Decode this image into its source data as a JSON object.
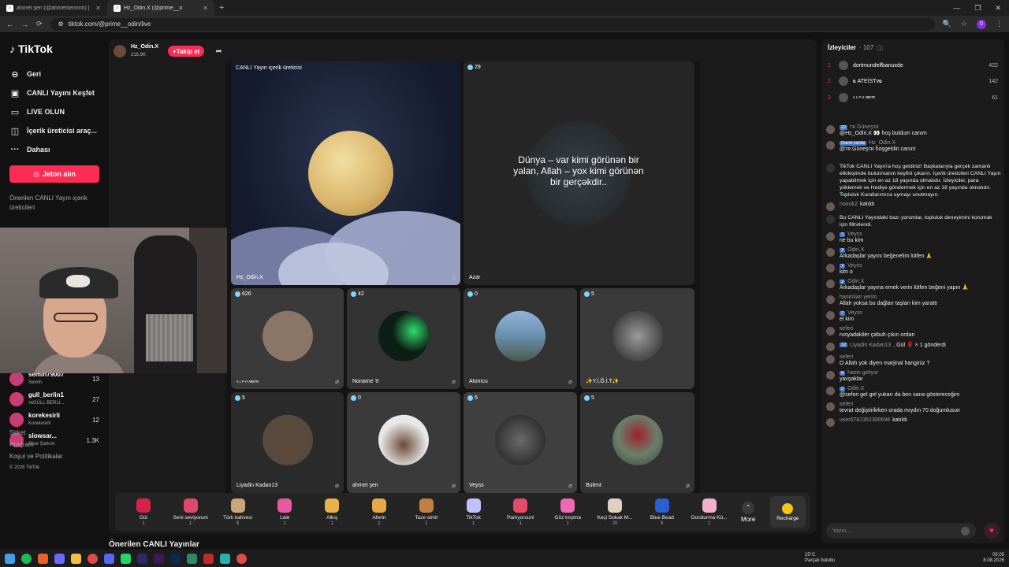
{
  "browser": {
    "tabs": [
      {
        "label": "ahmet şen (@ahmetsennnn) |",
        "active": false
      },
      {
        "label": "Hz_Odin.X (@prime__o",
        "active": true
      }
    ],
    "url": "tiktok.com/@prime__odin/live",
    "profile_initial": "0"
  },
  "sidebar": {
    "logo": "TikTok",
    "nav": [
      {
        "icon": "arrow-left-icon",
        "label": "Geri"
      },
      {
        "icon": "live-tv-icon",
        "label": "CANLI Yayını Keşfet"
      },
      {
        "icon": "camera-icon",
        "label": "LIVE OLUN"
      },
      {
        "icon": "creator-tools-icon",
        "label": "İçerik üreticisi araç..."
      },
      {
        "icon": "more-icon",
        "label": "Dahası"
      }
    ],
    "jeton_button": "Jeton alın",
    "suggested_heading": "Önerilen CANLI Yayın içerik üreticileri",
    "accounts": [
      {
        "name": "semih79007",
        "sub": "Semih",
        "count": "13"
      },
      {
        "name": "gull_berlin1",
        "sub": "ᴛʀGÜLL BERLİ...",
        "count": "27"
      },
      {
        "name": "korekesirli",
        "sub": "Korekesirli",
        "count": "12"
      },
      {
        "name": "slowsar...",
        "sub": "Slow Şarkım",
        "count": "1.3K"
      }
    ],
    "footer": [
      "Şirket",
      "Program",
      "Koşul ve Politikalar"
    ],
    "copyright": "© 2026 TikTok"
  },
  "stream": {
    "host_name": "Hz_Odin.X",
    "host_likes": "216.9K",
    "follow_label": "+Takip et",
    "main_tile_caption": "CANLI Yayın içerik üreticisi",
    "main_tile_name": "Hz_Odin.X",
    "second_tile": {
      "count": "29",
      "name": "Azar",
      "quote": "Dünya – var kimi görünən bir yalan, Allah – yox kimi görünən bir gerçəkdir.."
    },
    "tiles": [
      {
        "count": "626",
        "name": "ᴀ ʟ ᴘ ʜ ᴀʙᴇᴛʀ",
        "color": "#8a7566"
      },
      {
        "count": "42",
        "name": "Noname ♉",
        "color": "#0d1e16"
      },
      {
        "count": "0",
        "name": "Atomcu",
        "color": "#6a8fae"
      },
      {
        "count": "5",
        "name": "✨Y.İ.Ğ.İ.T✨",
        "color": "#4a4a4a"
      },
      {
        "count": "5",
        "name": "Liyadin Kadan13",
        "color": "#5a4a3e"
      },
      {
        "count": "0",
        "name": "ahmet şen",
        "color": "#e8e8e8"
      },
      {
        "count": "5",
        "name": "Veyss",
        "color": "#3a3a3a"
      },
      {
        "count": "5",
        "name": "Bülent",
        "color": "#6b7f6a"
      }
    ]
  },
  "gifts": [
    {
      "name": "Gül",
      "price": "1",
      "color": "#d8224a"
    },
    {
      "name": "Seni seviyorum",
      "price": "1",
      "color": "#e04a6a"
    },
    {
      "name": "Türk kahvesi",
      "price": "5",
      "color": "#c9a77a"
    },
    {
      "name": "Lale",
      "price": "1",
      "color": "#e85aa0"
    },
    {
      "name": "Alkış",
      "price": "1",
      "color": "#e8b24a"
    },
    {
      "name": "Aferin",
      "price": "1",
      "color": "#e8a84a"
    },
    {
      "name": "Taze simit",
      "price": "1",
      "color": "#c08040"
    },
    {
      "name": "TikTok",
      "price": "1",
      "color": "#c0c0ff"
    },
    {
      "name": "Parlıyorsun!",
      "price": "1",
      "color": "#e84a6a"
    },
    {
      "name": "Göz kırpma",
      "price": "1",
      "color": "#f06ab0"
    },
    {
      "name": "Keçi Sokak M...",
      "price": "20",
      "color": "#e0d0c0"
    },
    {
      "name": "Blue Bead",
      "price": "5",
      "color": "#2a60d0"
    },
    {
      "name": "Dondurma Kü...",
      "price": "1",
      "color": "#f0b0c8"
    }
  ],
  "gift_more": "More",
  "recharge": "Recharge",
  "suggested_lives": "Önerilen CANLI Yayınlar",
  "chat": {
    "title": "İzleyiciler",
    "viewer_count": "· 107",
    "ranking": [
      {
        "rank": "1",
        "name": "dortmundelfbanuxde",
        "score": "422"
      },
      {
        "rank": "2",
        "name": "ҩ ATEİSTvҩ",
        "score": "142"
      },
      {
        "rank": "3",
        "name": "ᴀ ʟ ᴘ ʜ ᴀʙᴇᴛʀ",
        "score": "61"
      }
    ],
    "messages": [
      {
        "user": "ᴛʀ Güneşᴛʀ",
        "badge": "22",
        "text": "@Hz_Odin.X 👀 hoş buldum canım"
      },
      {
        "user": "Hz_Odin.X",
        "badge": "Davet sahibi",
        "text": "@ᴛʀ Güneşᴛʀ hoşgeldin canım"
      },
      {
        "user": "",
        "badge": "",
        "text": "TikTok CANLI Yayın'a hoş geldiniz! Başkalarıyla gerçek zamanlı etkileşimde bulunmanın keyfini çıkarın. İçerik üreticileri CANLI Yayın yapabilmek için en az 18 yaşında olmalıdır. İzleyiciler, para yüklemek ve Hediye göndermek için en az 18 yaşında olmalıdır. Topluluk Kurallarımıza uymayı unutmayın.",
        "system": true
      },
      {
        "user": "noirok2",
        "badge": "",
        "text": "katıldı",
        "inline": true
      },
      {
        "user": "",
        "badge": "",
        "text": "Bu CANLI Yayındaki bazı yorumlar, topluluk deneyimini korumak için filtrelendi.",
        "system": true
      },
      {
        "user": "Veyss",
        "badge": "7",
        "text": "ne bu kim"
      },
      {
        "user": "Odin.X",
        "badge": "2",
        "text": "Arkadaşlar yayını beğenelim lütfen 🙏"
      },
      {
        "user": "Veyss",
        "badge": "7",
        "text": "kim o"
      },
      {
        "user": "Odin.X",
        "badge": "2",
        "text": "Arkadaşlar yayına emek verin lütfen beğeni yapın 🙏"
      },
      {
        "user": "hanimlari yerim",
        "badge": "",
        "text": "Allah yoksa bu dağları taşları kim yarattı"
      },
      {
        "user": "Veyss",
        "badge": "7",
        "text": "el kim"
      },
      {
        "user": "seferi",
        "badge": "",
        "text": "rusyadakiler çabuh çıkın ordan"
      },
      {
        "user": "Liyadin Kadan13",
        "badge": "12",
        "text": ", Gül 🌹 × 1 gönderdi",
        "inline": true
      },
      {
        "user": "seferi",
        "badge": "",
        "text": "O Allah yok diyen marjinal hanginiz ?"
      },
      {
        "user": "hazin geliyor",
        "badge": "9",
        "text": "yavşaklar"
      },
      {
        "user": "Odin.X",
        "badge": "2",
        "text": "@seferi gel gel yukarı da ben sana göstereceğim"
      },
      {
        "user": "seferi",
        "badge": "",
        "text": "tevrat değiştirilirken orada mıydın 70 doğumlusun"
      },
      {
        "user": "user5781352300696",
        "badge": "",
        "text": "katıldı",
        "inline": true
      }
    ],
    "input_placeholder": "Yazın..."
  },
  "taskbar": {
    "temperature": "25°C",
    "weather": "Parçalı bulutlu",
    "time": "05:05",
    "date": "8.08.2026"
  }
}
